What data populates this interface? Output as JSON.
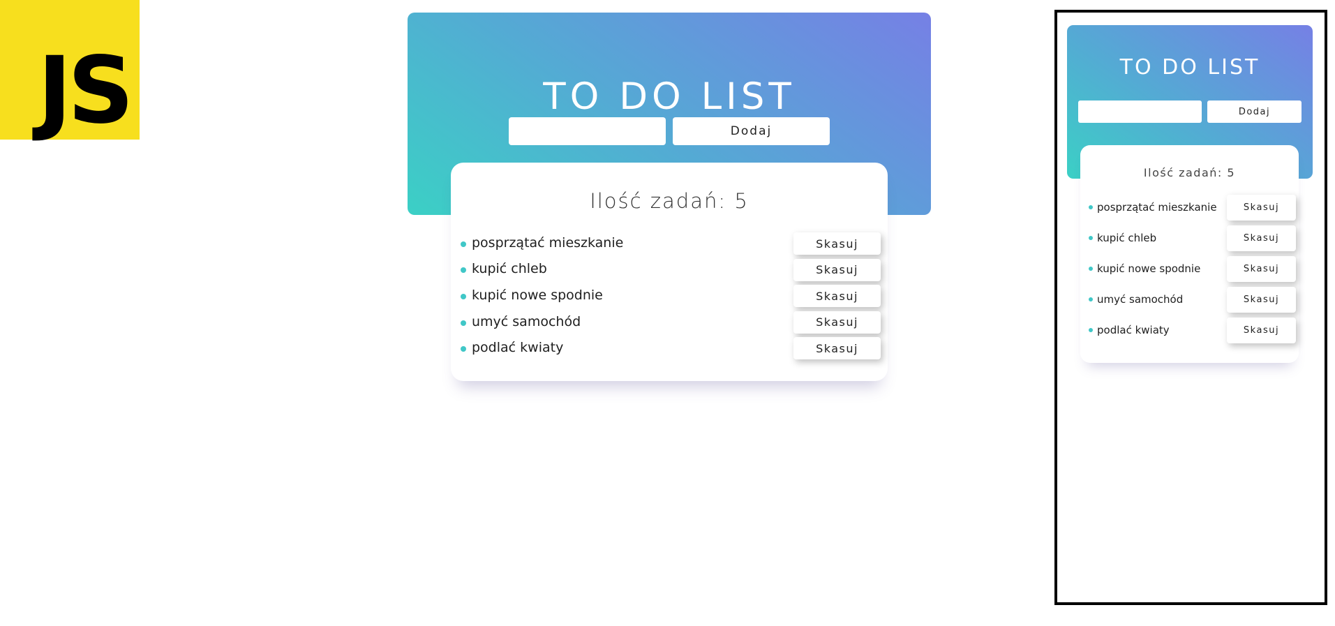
{
  "logo": {
    "text": "JS",
    "background": "#f7df1e",
    "color": "#000000"
  },
  "app": {
    "title": "TO DO LIST",
    "input": {
      "value": "",
      "placeholder": ""
    },
    "add_button_label": "Dodaj",
    "count_text": "Ilość zadań: 5",
    "delete_button_label": "Skasuj",
    "tasks": [
      {
        "text": "posprzątać mieszkanie"
      },
      {
        "text": "kupić chleb"
      },
      {
        "text": "kupić nowe spodnie"
      },
      {
        "text": "umyć samochód"
      },
      {
        "text": "podlać kwiaty"
      }
    ],
    "colors": {
      "gradient_start": "#3bd0c5",
      "gradient_end": "#7680e5",
      "bullet": "#40c7c7"
    }
  },
  "mobile": {
    "title": "TO DO LIST",
    "add_button_label": "Dodaj",
    "count_text": "Ilość zadań: 5",
    "delete_button_label": "Skasuj",
    "tasks": [
      {
        "text": "posprzątać mieszkanie"
      },
      {
        "text": "kupić chleb"
      },
      {
        "text": "kupić nowe spodnie"
      },
      {
        "text": "umyć samochód"
      },
      {
        "text": "podlać kwiaty"
      }
    ]
  }
}
